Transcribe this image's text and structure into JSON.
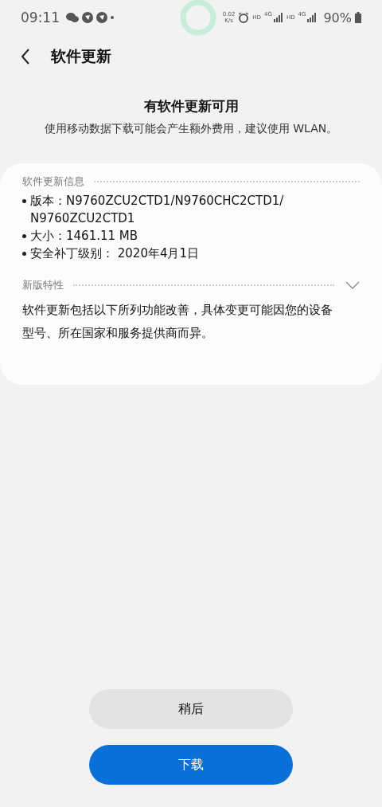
{
  "status_bar": {
    "time": "09:11",
    "net_speed": [
      "0.02",
      "K/s"
    ],
    "sim1": {
      "hd": "HD",
      "network": "4G"
    },
    "sim2": {
      "hd": "HD",
      "network": "4G"
    },
    "battery": "90%"
  },
  "header": {
    "title": "软件更新"
  },
  "intro": {
    "title": "有软件更新可用",
    "subtitle": "使用移动数据下载可能会产生额外费用，建议使用 WLAN。"
  },
  "info": {
    "heading": "软件更新信息",
    "items": [
      {
        "label": "版本：",
        "value": "N9760ZCU2CTD1/N9760CHC2CTD1/N9760ZCU2CTD1"
      },
      {
        "label": "大小：",
        "value": "1461.11 MB"
      },
      {
        "label": "安全补丁级别：",
        "value": " 2020年4月1日"
      }
    ]
  },
  "features": {
    "heading": "新版特性",
    "expanded": true,
    "text": "软件更新包括以下所列功能改善，具体变更可能因您的设备型号、所在国家和服务提供商而异。"
  },
  "buttons": [
    {
      "label": "稍后",
      "kind": "secondary"
    },
    {
      "label": "下载",
      "kind": "primary"
    }
  ]
}
